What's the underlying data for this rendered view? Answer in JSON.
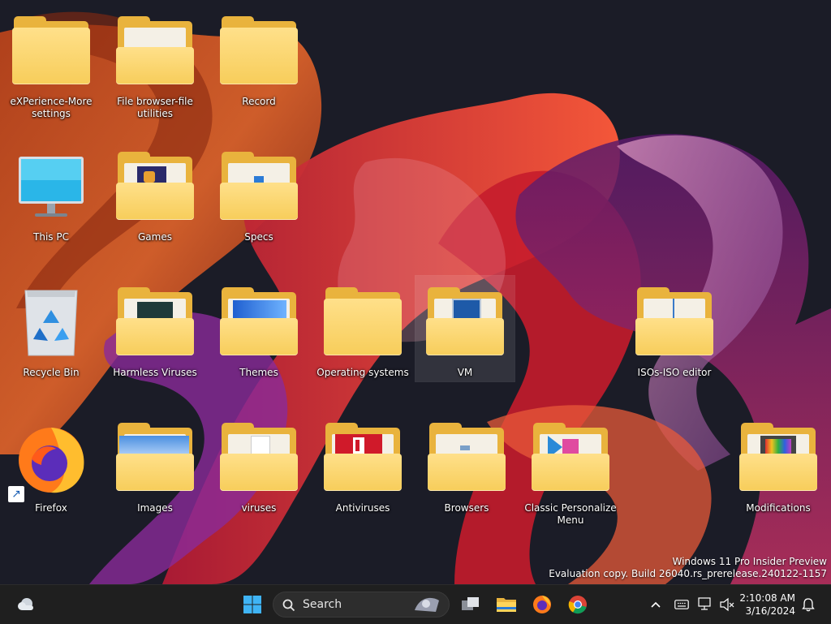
{
  "desktop": {
    "icons": [
      {
        "label": "eXPerience-More settings"
      },
      {
        "label": "File browser-file utilities"
      },
      {
        "label": "Record"
      },
      {
        "label": "This PC"
      },
      {
        "label": "Games"
      },
      {
        "label": "Specs"
      },
      {
        "label": "Recycle Bin"
      },
      {
        "label": "Harmless Viruses"
      },
      {
        "label": "Themes"
      },
      {
        "label": "Operating systems"
      },
      {
        "label": "VM"
      },
      {
        "label": "ISOs-ISO editor"
      },
      {
        "label": "Firefox"
      },
      {
        "label": "Images"
      },
      {
        "label": "viruses"
      },
      {
        "label": "Antiviruses"
      },
      {
        "label": "Browsers"
      },
      {
        "label": "Classic Personalize Menu"
      },
      {
        "label": "Modifications"
      }
    ]
  },
  "watermark": {
    "line1": "Windows 11 Pro Insider Preview",
    "line2": "Evaluation copy. Build 26040.rs_prerelease.240122-1157"
  },
  "taskbar": {
    "search_label": "Search",
    "pinned": [
      {
        "icon": "start-icon"
      },
      {
        "icon": "task-view-icon"
      },
      {
        "icon": "file-explorer-icon"
      },
      {
        "icon": "firefox-icon"
      },
      {
        "icon": "chrome-icon"
      }
    ],
    "tray": {
      "time": "2:10:08 AM",
      "date": "3/16/2024"
    }
  },
  "colors": {
    "folder": "#f7cd5a",
    "taskbar": "#1f1f1f",
    "accent": "#0078d4"
  }
}
